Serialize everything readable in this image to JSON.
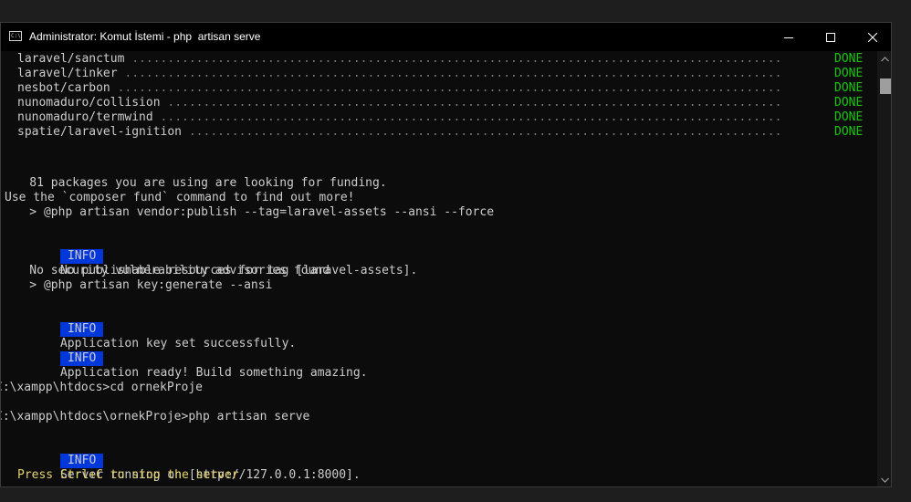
{
  "window": {
    "title": "Administrator: Komut İstemi - php  artisan serve",
    "icon_label": "C:\\"
  },
  "colors": {
    "terminal_bg": "#0c0c0c",
    "text": "#cccccc",
    "done": "#16c60c",
    "info_bg": "#0037da",
    "dim_dots": "#767676",
    "yellow": "#e5d26f"
  },
  "packages": [
    {
      "name": "laravel/sanctum",
      "status": "DONE"
    },
    {
      "name": "laravel/tinker",
      "status": "DONE"
    },
    {
      "name": "nesbot/carbon",
      "status": "DONE"
    },
    {
      "name": "nunomaduro/collision",
      "status": "DONE"
    },
    {
      "name": "nunomaduro/termwind",
      "status": "DONE"
    },
    {
      "name": "spatie/laravel-ignition",
      "status": "DONE"
    }
  ],
  "lines": {
    "funding": "    81 packages you are using are looking for funding.",
    "fund_hint": "Use the `composer fund` command to find out more!",
    "publish_cmd": "    > @php artisan vendor:publish --tag=laravel-assets --ansi --force",
    "info_label": "INFO",
    "info_assets": "No publishable resources for tag [laravel-assets].",
    "no_vuln": "    No security vulnerability advisories found",
    "keygen_cmd": "    > @php artisan key:generate --ansi",
    "info_key": "Application key set successfully.",
    "info_ready": "Application ready! Build something amazing.",
    "prompt_cd": "C:\\xampp\\htdocs>cd ornekProje",
    "prompt_serve": "C:\\xampp\\htdocs\\ornekProje>php artisan serve",
    "info_server": "Server running on [http://127.0.0.1:8000].",
    "stop_hint": "Press Ctrl+C to stop the server"
  }
}
